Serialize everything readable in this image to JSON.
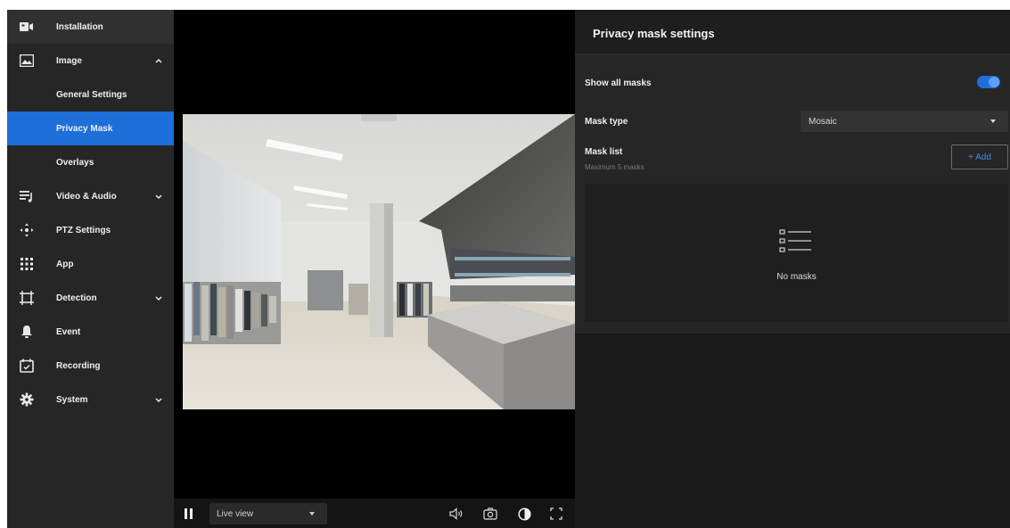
{
  "sidebar": {
    "items": [
      {
        "label": "Installation",
        "icon": "video-camera-icon"
      },
      {
        "label": "Image",
        "icon": "image-icon"
      },
      {
        "label": "General Settings"
      },
      {
        "label": "Privacy Mask"
      },
      {
        "label": "Overlays"
      },
      {
        "label": "Video & Audio",
        "icon": "video-audio-icon"
      },
      {
        "label": "PTZ Settings",
        "icon": "ptz-move-icon"
      },
      {
        "label": "App",
        "icon": "app-grid-icon"
      },
      {
        "label": "Detection",
        "icon": "detection-frame-icon"
      },
      {
        "label": "Event",
        "icon": "bell-icon"
      },
      {
        "label": "Recording",
        "icon": "calendar-icon"
      },
      {
        "label": "System",
        "icon": "gear-icon"
      }
    ]
  },
  "video": {
    "view_selected": "Live view",
    "controls": [
      "pause-icon",
      "volume-icon",
      "snapshot-icon",
      "contrast-icon",
      "fullscreen-icon"
    ]
  },
  "panel": {
    "title": "Privacy mask settings",
    "show_all_label": "Show all masks",
    "show_all_on": true,
    "mask_type_label": "Mask type",
    "mask_type_value": "Mosaic",
    "mask_list_label": "Mask list",
    "mask_list_hint": "Maximum 5 masks",
    "add_label": "+ Add",
    "empty_text": "No masks"
  },
  "colors": {
    "accent": "#1e6fd9",
    "sidebar_bg": "#262626",
    "panel_bg": "#1a1a1a"
  }
}
